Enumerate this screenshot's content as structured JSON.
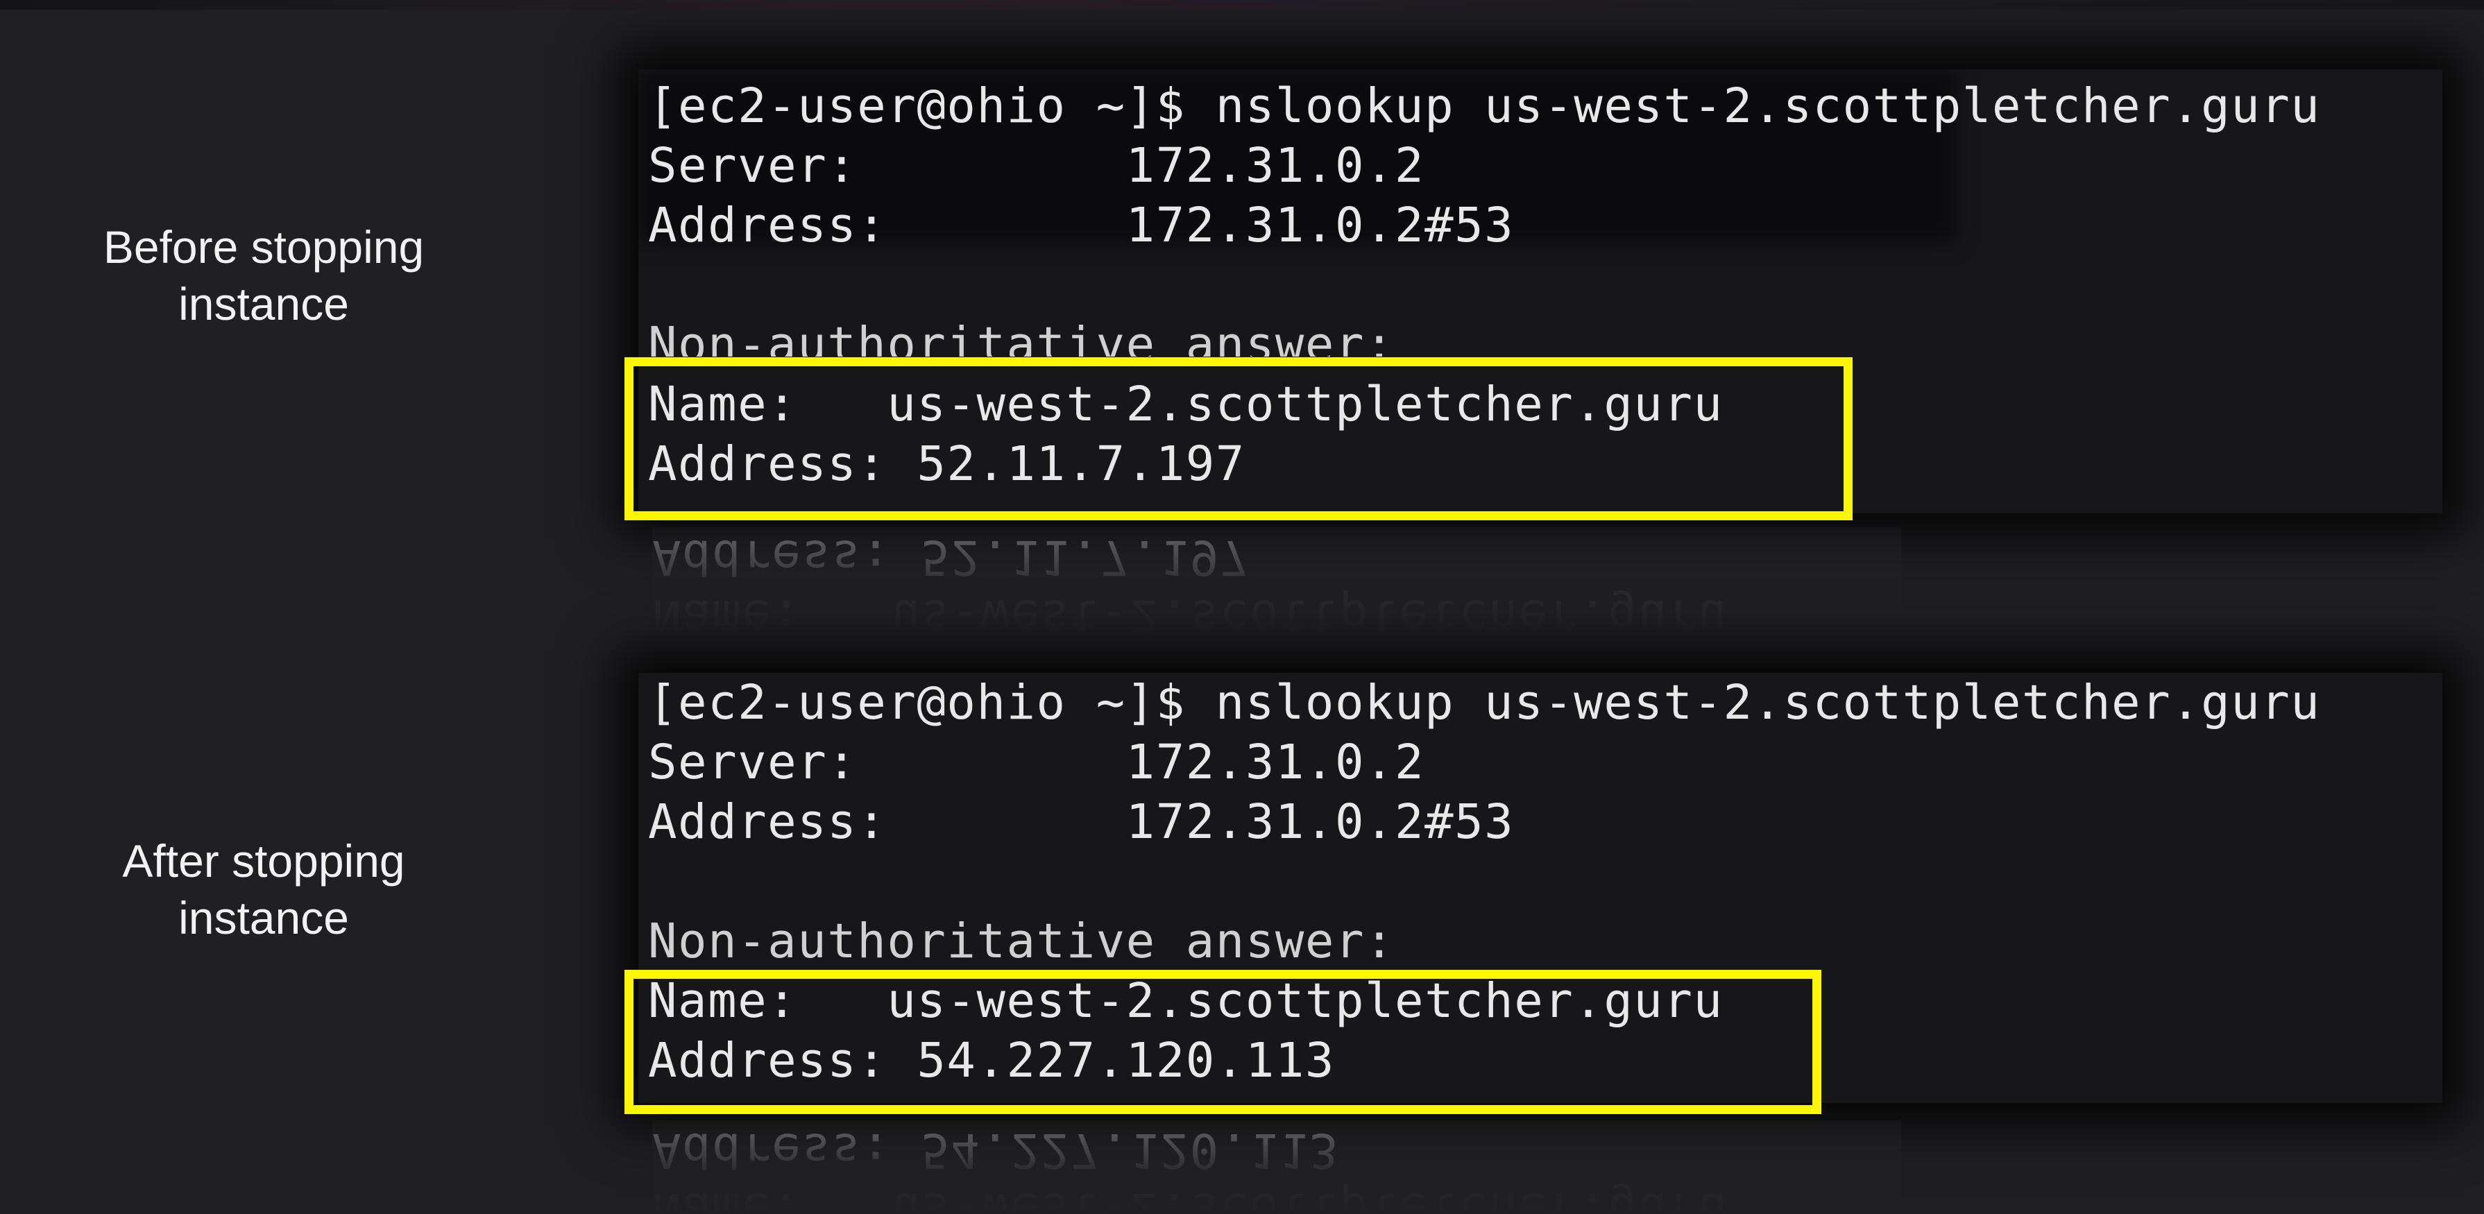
{
  "labels": {
    "before": [
      "Before stopping",
      "instance"
    ],
    "after": [
      "After stopping",
      "instance"
    ]
  },
  "before": {
    "command": "[ec2-user@ohio ~]$ nslookup us-west-2.scottpletcher.guru",
    "server": "Server:\t\t172.31.0.2",
    "server_address": "Address:\t172.31.0.2#53",
    "answer_header": "Non-authoritative answer:",
    "name": "Name:\tus-west-2.scottpletcher.guru",
    "address": "Address: 52.11.7.197"
  },
  "after": {
    "command": "[ec2-user@ohio ~]$ nslookup us-west-2.scottpletcher.guru",
    "server": "Server:\t\t172.31.0.2",
    "server_address": "Address:\t172.31.0.2#53",
    "answer_header": "Non-authoritative answer:",
    "name": "Name:\tus-west-2.scottpletcher.guru",
    "address": "Address: 54.227.120.113"
  },
  "colors": {
    "background": "#202023",
    "terminal": "#171719",
    "highlight": "#fbf700",
    "text": "#e8e8e8"
  }
}
